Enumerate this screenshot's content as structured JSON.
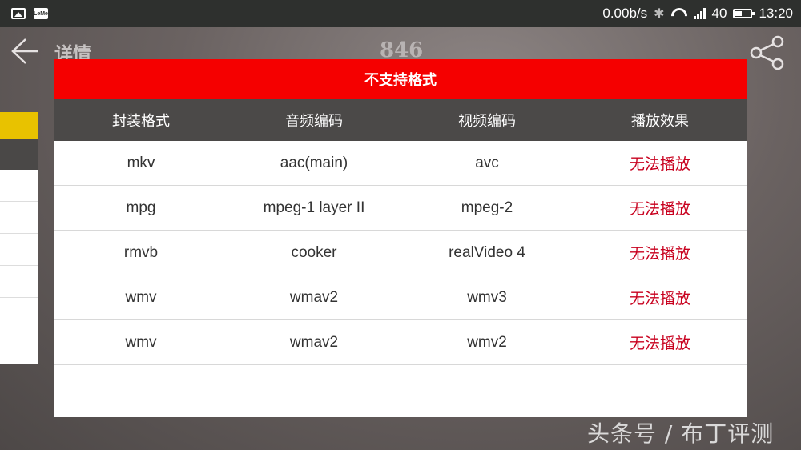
{
  "status_bar": {
    "net_speed": "0.00b/s",
    "signal_label": "40",
    "time": "13:20",
    "app_icon_text": "LeMe"
  },
  "background": {
    "title": "详情",
    "count": "846"
  },
  "dialog": {
    "title": "不支持格式",
    "headers": [
      "封装格式",
      "音频编码",
      "视频编码",
      "播放效果"
    ],
    "rows": [
      [
        "mkv",
        "aac(main)",
        "avc",
        "无法播放"
      ],
      [
        "mpg",
        "mpeg-1 layer II",
        "mpeg-2",
        "无法播放"
      ],
      [
        "rmvb",
        "cooker",
        "realVideo 4",
        "无法播放"
      ],
      [
        "wmv",
        "wmav2",
        "wmv3",
        "无法播放"
      ],
      [
        "wmv",
        "wmav2",
        "wmv2",
        "无法播放"
      ]
    ]
  },
  "watermark": "头条号 / 布丁评测",
  "colors": {
    "dialog_title_bg": "#f50000",
    "header_bg": "#4b4948",
    "result_text": "#c8001e",
    "accent_yellow": "#e8c200"
  }
}
